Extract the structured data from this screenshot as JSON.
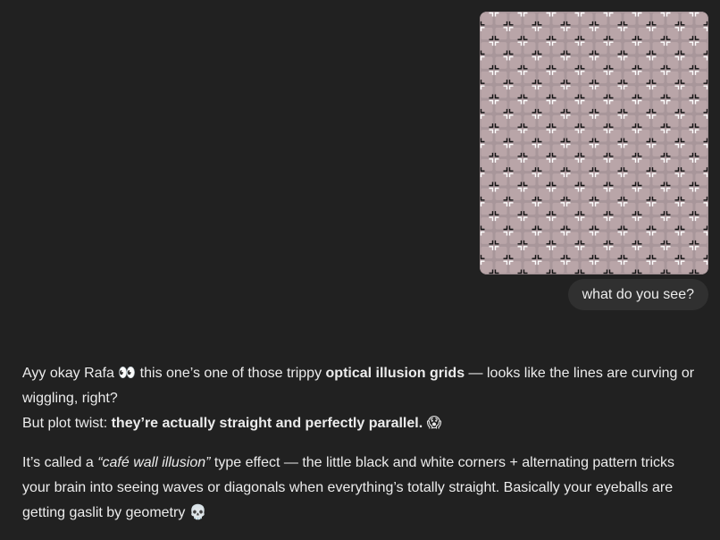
{
  "user_message": {
    "image_alt": "optical illusion grid",
    "text": "what do you see?"
  },
  "assistant_reply": {
    "p1": {
      "t1": "Ayy okay Rafa ",
      "emoji1": "👀",
      "t2": " this one’s one of those trippy ",
      "b1": "optical illusion grids",
      "t3": " — looks like the lines are curving or wiggling, right?",
      "t4": "But plot twist: ",
      "b2": "they’re actually straight and perfectly parallel.",
      "emoji2": "😱"
    },
    "p2": {
      "t1": "It’s called a ",
      "i1": "“café wall illusion”",
      "t2": " type effect — the little black and white corners + alternating pattern tricks your brain into seeing waves or diagonals when everything’s totally straight. Basically your eyeballs are getting gaslit by geometry ",
      "emoji1": "💀"
    }
  },
  "colors": {
    "background": "#212121",
    "bubble": "#303030",
    "text": "#ececec",
    "tile": "#b9a5a8"
  }
}
